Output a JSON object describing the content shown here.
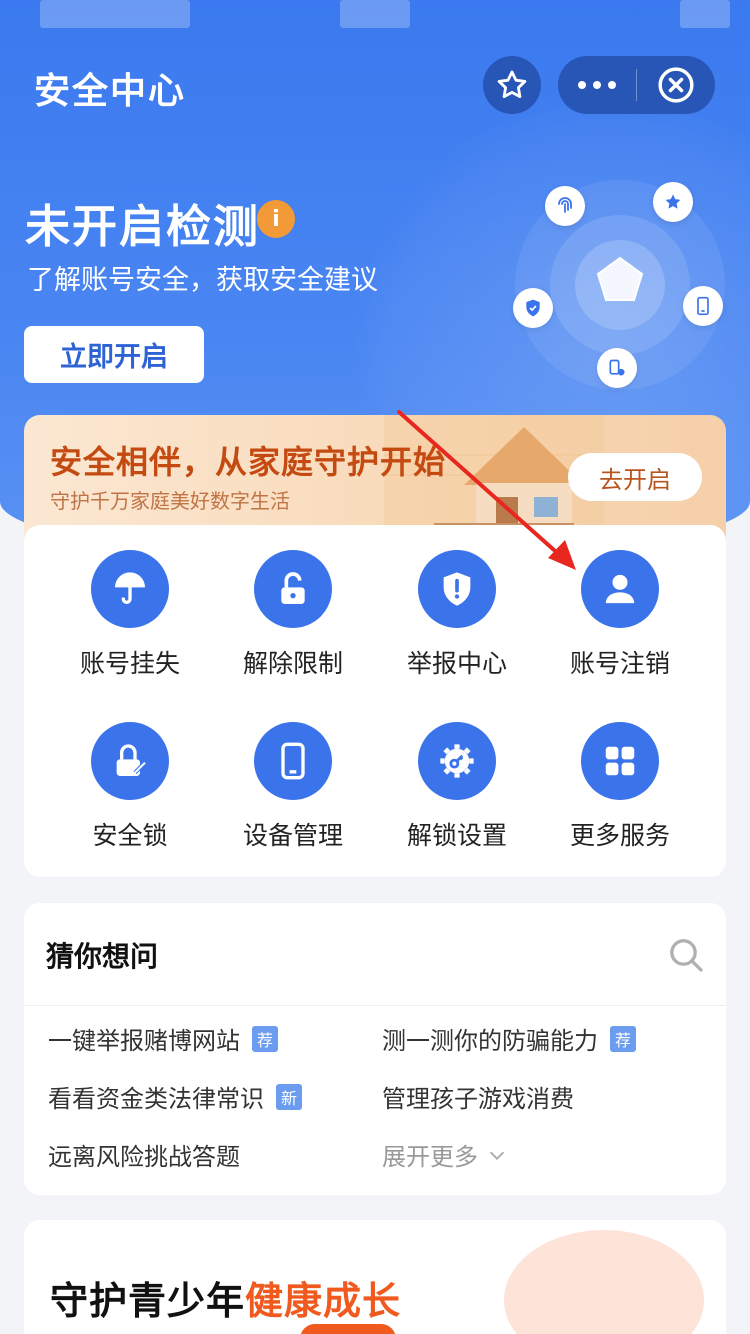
{
  "header": {
    "app_title": "安全中心",
    "star_icon": "star-icon",
    "more_icon": "more-dots-icon",
    "close_icon": "close-circle-icon"
  },
  "hero": {
    "status_title": "未开启检测",
    "info_badge": "i",
    "subtitle": "了解账号安全，获取安全建议",
    "enable_button": "立即开启"
  },
  "banner": {
    "title": "安全相伴，从家庭守护开始",
    "subtitle": "守护千万家庭美好数字生活",
    "button": "去开启"
  },
  "services": [
    {
      "label": "账号挂失",
      "icon": "umbrella-icon"
    },
    {
      "label": "解除限制",
      "icon": "unlock-icon"
    },
    {
      "label": "举报中心",
      "icon": "report-shield-icon"
    },
    {
      "label": "账号注销",
      "icon": "user-icon"
    },
    {
      "label": "安全锁",
      "icon": "lock-edit-icon"
    },
    {
      "label": "设备管理",
      "icon": "phone-icon"
    },
    {
      "label": "解锁设置",
      "icon": "gear-key-icon"
    },
    {
      "label": "更多服务",
      "icon": "grid-icon"
    }
  ],
  "faq": {
    "title": "猜你想问",
    "items": [
      {
        "text": "一键举报赌博网站",
        "tag": "荐"
      },
      {
        "text": "测一测你的防骗能力",
        "tag": "荐"
      },
      {
        "text": "看看资金类法律常识",
        "tag": "新"
      },
      {
        "text": "管理孩子游戏消费",
        "tag": ""
      },
      {
        "text": "远离风险挑战答题",
        "tag": ""
      }
    ],
    "expand_more": "展开更多"
  },
  "teen": {
    "title_part1": "守护青少年",
    "title_part2": "健康成长"
  },
  "colors": {
    "primary": "#3b73ea",
    "hero_bg": "#3a79ef",
    "banner_text": "#c54a12",
    "accent_orange": "#f05a1f",
    "info_orange": "#f29a38",
    "annotation_arrow": "#e8281f"
  }
}
